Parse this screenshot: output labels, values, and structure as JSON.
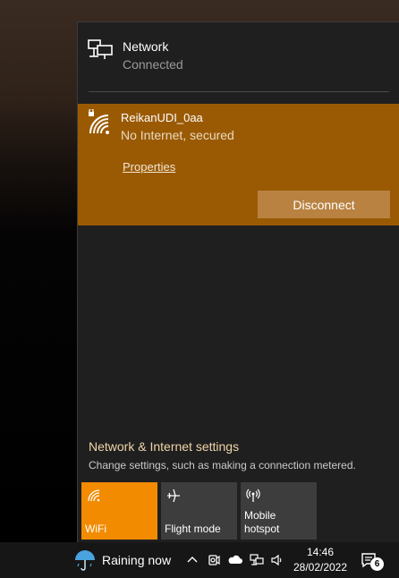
{
  "network": {
    "title": "Network",
    "status": "Connected"
  },
  "wifi": {
    "ssid": "ReikanUDI_0aa",
    "status": "No Internet, secured",
    "properties_label": "Properties",
    "disconnect_label": "Disconnect",
    "accent_color": "#9a5a04"
  },
  "settings": {
    "link_label": "Network & Internet settings",
    "description": "Change settings, such as making a connection metered."
  },
  "quick_actions": [
    {
      "label": "WiFi",
      "icon": "wifi-icon",
      "active": true
    },
    {
      "label": "Flight mode",
      "icon": "airplane-icon",
      "active": false
    },
    {
      "label": "Mobile\nhotspot",
      "icon": "hotspot-icon",
      "active": false
    }
  ],
  "taskbar": {
    "weather_text": "Raining now",
    "time": "14:46",
    "date": "28/02/2022",
    "notification_count": "6"
  }
}
